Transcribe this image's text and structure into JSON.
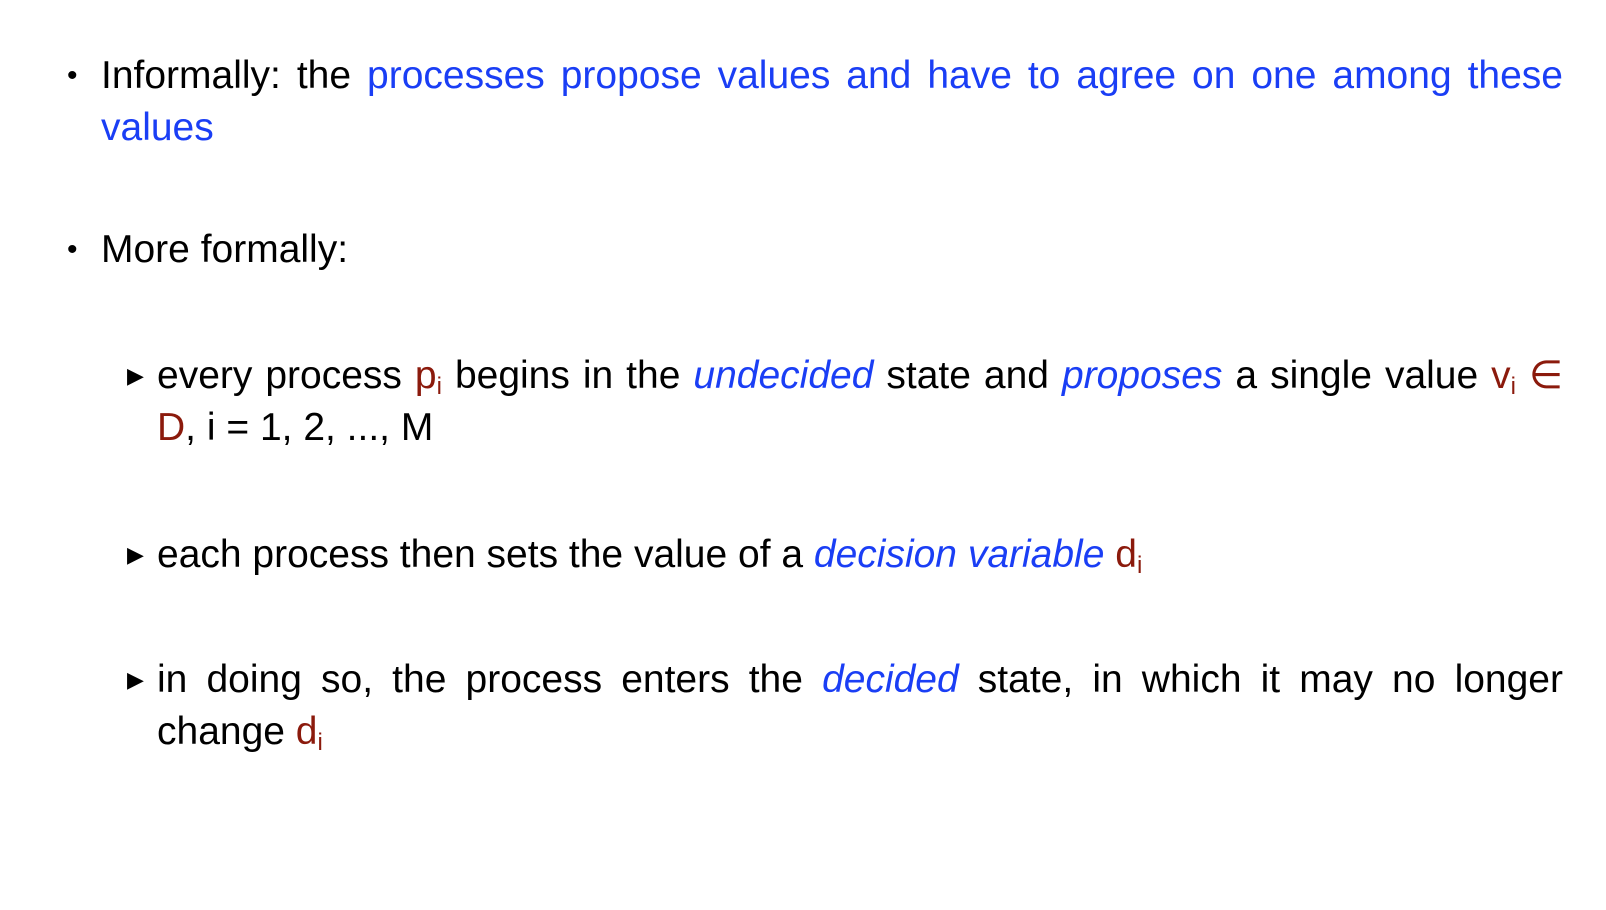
{
  "slide": {
    "bullet_marker_l1": "•",
    "bullet_marker_l2": "▶",
    "items": [
      {
        "prefix": "Informally: the ",
        "highlight": "processes propose values and have to agree on one among these values"
      },
      {
        "text": "More formally:"
      }
    ],
    "subitems": [
      {
        "t1": "every process ",
        "p": "p",
        "p_sub": "i",
        "t2": " begins in the ",
        "em1": "undecided",
        "t3": " state and ",
        "em2": "proposes",
        "t4": " a single value ",
        "v": "v",
        "v_sub": "i",
        "in_sym": " ∈ D",
        "t5": ", i = 1, 2, ..., M"
      },
      {
        "t1": "each process then sets the value of a ",
        "em1": "decision variable",
        "d": " d",
        "d_sub": "i"
      },
      {
        "t1": "in doing so, the process enters the ",
        "em1": "decided",
        "t2": " state, in which it may no longer change ",
        "d": "d",
        "d_sub": "i"
      }
    ]
  },
  "colors": {
    "highlight_blue": "#1a3ef5",
    "variable_red": "#8b1a0c",
    "text": "#000000",
    "background": "#ffffff"
  }
}
